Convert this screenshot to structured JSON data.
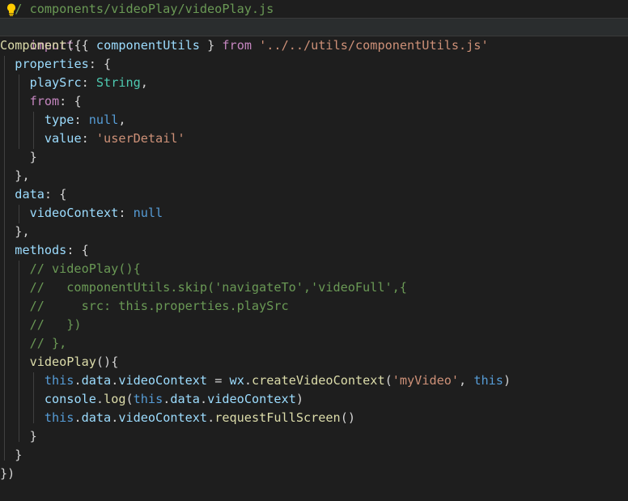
{
  "editor": {
    "lines": [
      "/ components/videoPlay/videoPlay.js",
      "import { componentUtils } from '../../utils/componentUtils.js'",
      "Component({",
      "  properties: {",
      "    playSrc: String,",
      "    from: {",
      "      type: null,",
      "      value: 'userDetail'",
      "    }",
      "  },",
      "  data: {",
      "    videoContext: null",
      "  },",
      "  methods: {",
      "    // videoPlay(){",
      "    //   componentUtils.skip('navigateTo','videoFull',{",
      "    //     src: this.properties.playSrc",
      "    //   })",
      "    // },",
      "    videoPlay(){",
      "      this.data.videoContext = wx.createVideoContext('myVideo', this)",
      "      console.log(this.data.videoContext)",
      "      this.data.videoContext.requestFullScreen()",
      "    }",
      "  }",
      "})"
    ],
    "lightbulb_icon": "lightbulb-icon",
    "colors": {
      "background": "#1e1e1e",
      "keyword": "#c586c0",
      "variable": "#9cdcfe",
      "type": "#4ec9b0",
      "string": "#ce9178",
      "constant": "#569cd6",
      "function": "#dcdcaa",
      "comment": "#6a9955",
      "text": "#d4d4d4"
    }
  }
}
